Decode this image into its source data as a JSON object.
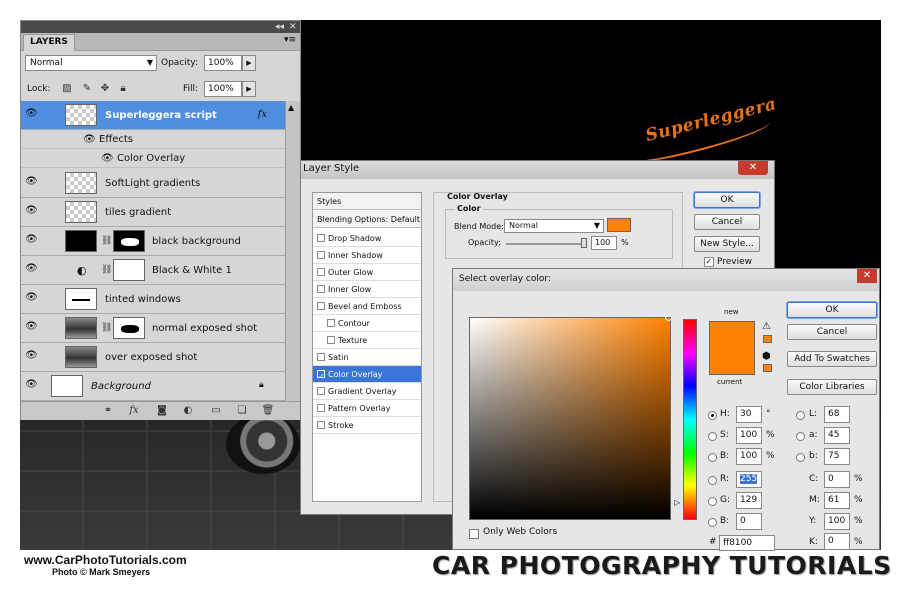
{
  "background": {
    "logo_script": "Superleggera"
  },
  "footer": {
    "site_url": "www.CarPhotoTutorials.com",
    "photo_credit": "Photo © Mark Smeyers",
    "brand_title": "CAR PHOTOGRAPHY TUTORIALS"
  },
  "layers_panel": {
    "tab": "LAYERS",
    "blend_mode": "Normal",
    "opacity_label": "Opacity:",
    "opacity": "100%",
    "lock_label": "Lock:",
    "fill_label": "Fill:",
    "fill": "100%",
    "layers": [
      {
        "name": "Superleggera script",
        "selected": true,
        "fx": "fx"
      },
      {
        "name": "SoftLight gradients"
      },
      {
        "name": "tiles gradient"
      },
      {
        "name": "black background"
      },
      {
        "name": "Black & White 1"
      },
      {
        "name": "tinted windows"
      },
      {
        "name": "normal exposed shot"
      },
      {
        "name": "over exposed shot"
      },
      {
        "name": "Background"
      }
    ],
    "effects_label": "Effects",
    "effect_item": "Color Overlay"
  },
  "layer_style": {
    "title": "Layer Style",
    "styles_header": "Styles",
    "blending_options": "Blending Options: Default",
    "items": [
      "Drop Shadow",
      "Inner Shadow",
      "Outer Glow",
      "Inner Glow",
      "Bevel and Emboss",
      "Contour",
      "Texture",
      "Satin",
      "Color Overlay",
      "Gradient Overlay",
      "Pattern Overlay",
      "Stroke"
    ],
    "section_title": "Color Overlay",
    "group_title": "Color",
    "blend_mode_label": "Blend Mode:",
    "blend_mode": "Normal",
    "opacity_label": "Opacity:",
    "opacity_value": "100",
    "percent": "%",
    "overlay_color": "#ff8100",
    "ok": "OK",
    "cancel": "Cancel",
    "new_style": "New Style...",
    "preview": "Preview"
  },
  "color_picker": {
    "title": "Select overlay color:",
    "ok": "OK",
    "cancel": "Cancel",
    "add_swatches": "Add To Swatches",
    "color_libraries": "Color Libraries",
    "new_label": "new",
    "current_label": "current",
    "color": "#ff8100",
    "H": "30",
    "H_unit": "°",
    "S": "100",
    "S_unit": "%",
    "B": "100",
    "B_unit": "%",
    "R": "255",
    "G": "129",
    "Bv": "0",
    "L": "68",
    "a": "45",
    "b": "75",
    "C": "0",
    "M": "61",
    "Y": "100",
    "K": "0",
    "cmyk_unit": "%",
    "web_colors": "Only Web Colors",
    "hex": "ff8100"
  }
}
